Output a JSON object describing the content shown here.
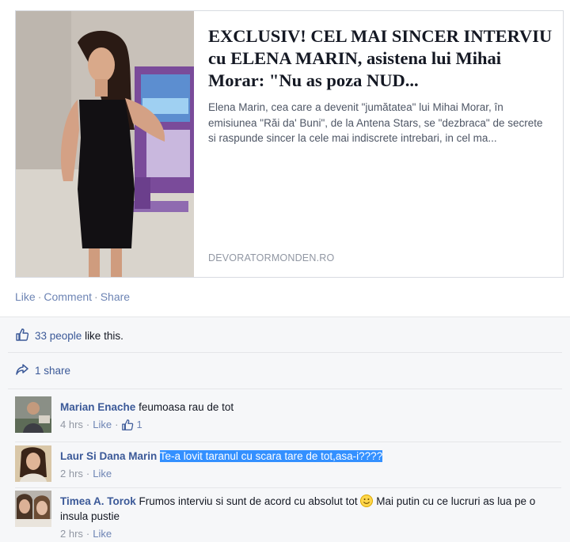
{
  "preview": {
    "title": "EXCLUSIV! CEL MAI SINCER INTERVIU cu ELENA MARIN, asistena lui Mihai Morar: \"Nu as poza NUD...",
    "description": "Elena Marin, cea care a devenit \"jumătatea\" lui Mihai Morar, în emisiunea \"Răi da' Buni\", de la Antena Stars, se \"dezbraca\" de secrete si raspunde sincer la cele mai indiscrete intrebari, in cel ma...",
    "domain": "DEVORATORMONDEN.RO",
    "image_icon": "photo-woman-black-dress"
  },
  "actions": {
    "like": "Like",
    "comment": "Comment",
    "share": "Share",
    "separator": "·"
  },
  "likes": {
    "count_text": "33 people",
    "suffix": " like this.",
    "icon": "thumbs-up-icon"
  },
  "shares": {
    "text": "1 share",
    "icon": "share-arrow-icon"
  },
  "comments": [
    {
      "author": "Marian Enache",
      "text": "feumoasa rau de tot",
      "time": "4 hrs",
      "like_label": "Like",
      "like_count": "1",
      "selected": false
    },
    {
      "author": "Laur Si Dana Marin",
      "text": "Te-a lovit taranul cu scara tare de tot,asa-i????",
      "time": "2 hrs",
      "like_label": "Like",
      "selected": true
    },
    {
      "author": "Timea A. Torok",
      "text": "Frumos interviu si sunt de acord cu absolut tot",
      "text_after_emoji": " Mai putin cu ce lucruri as lua pe o insula pustie",
      "emoji": "smiley-emoji",
      "time": "2 hrs",
      "like_label": "Like",
      "selected": false
    }
  ],
  "colors": {
    "link": "#3b5998",
    "muted": "#9197a3",
    "selection": "#3390ff"
  }
}
